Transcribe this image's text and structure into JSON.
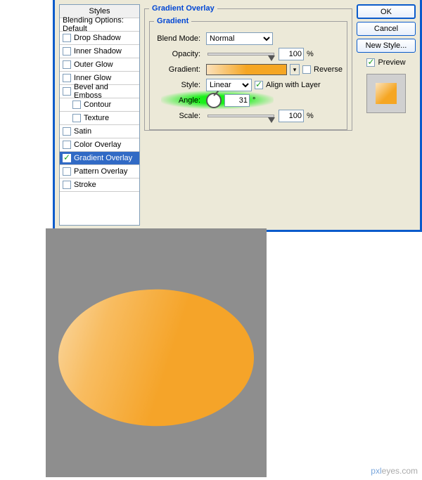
{
  "styles_panel": {
    "header": "Styles",
    "rows": [
      {
        "label": "Blending Options: Default",
        "checkbox": false,
        "checked": false,
        "sub": false
      },
      {
        "label": "Drop Shadow",
        "checkbox": true,
        "checked": false,
        "sub": false
      },
      {
        "label": "Inner Shadow",
        "checkbox": true,
        "checked": false,
        "sub": false
      },
      {
        "label": "Outer Glow",
        "checkbox": true,
        "checked": false,
        "sub": false
      },
      {
        "label": "Inner Glow",
        "checkbox": true,
        "checked": false,
        "sub": false
      },
      {
        "label": "Bevel and Emboss",
        "checkbox": true,
        "checked": false,
        "sub": false
      },
      {
        "label": "Contour",
        "checkbox": true,
        "checked": false,
        "sub": true
      },
      {
        "label": "Texture",
        "checkbox": true,
        "checked": false,
        "sub": true
      },
      {
        "label": "Satin",
        "checkbox": true,
        "checked": false,
        "sub": false
      },
      {
        "label": "Color Overlay",
        "checkbox": true,
        "checked": false,
        "sub": false
      },
      {
        "label": "Gradient Overlay",
        "checkbox": true,
        "checked": true,
        "sub": false,
        "selected": true
      },
      {
        "label": "Pattern Overlay",
        "checkbox": true,
        "checked": false,
        "sub": false
      },
      {
        "label": "Stroke",
        "checkbox": true,
        "checked": false,
        "sub": false
      }
    ]
  },
  "center": {
    "outer_legend": "Gradient Overlay",
    "inner_legend": "Gradient",
    "blend_mode_label": "Blend Mode:",
    "blend_mode_value": "Normal",
    "opacity_label": "Opacity:",
    "opacity_value": "100",
    "opacity_pct": "%",
    "gradient_label": "Gradient:",
    "reverse_label": "Reverse",
    "style_label": "Style:",
    "style_value": "Linear",
    "align_label": "Align with Layer",
    "angle_label": "Angle:",
    "angle_value": "31",
    "angle_deg": "°",
    "scale_label": "Scale:",
    "scale_value": "100",
    "scale_pct": "%"
  },
  "right": {
    "ok": "OK",
    "cancel": "Cancel",
    "new_style": "New Style...",
    "preview": "Preview"
  },
  "watermark": {
    "a": "pxl",
    "b": "eyes.com"
  }
}
